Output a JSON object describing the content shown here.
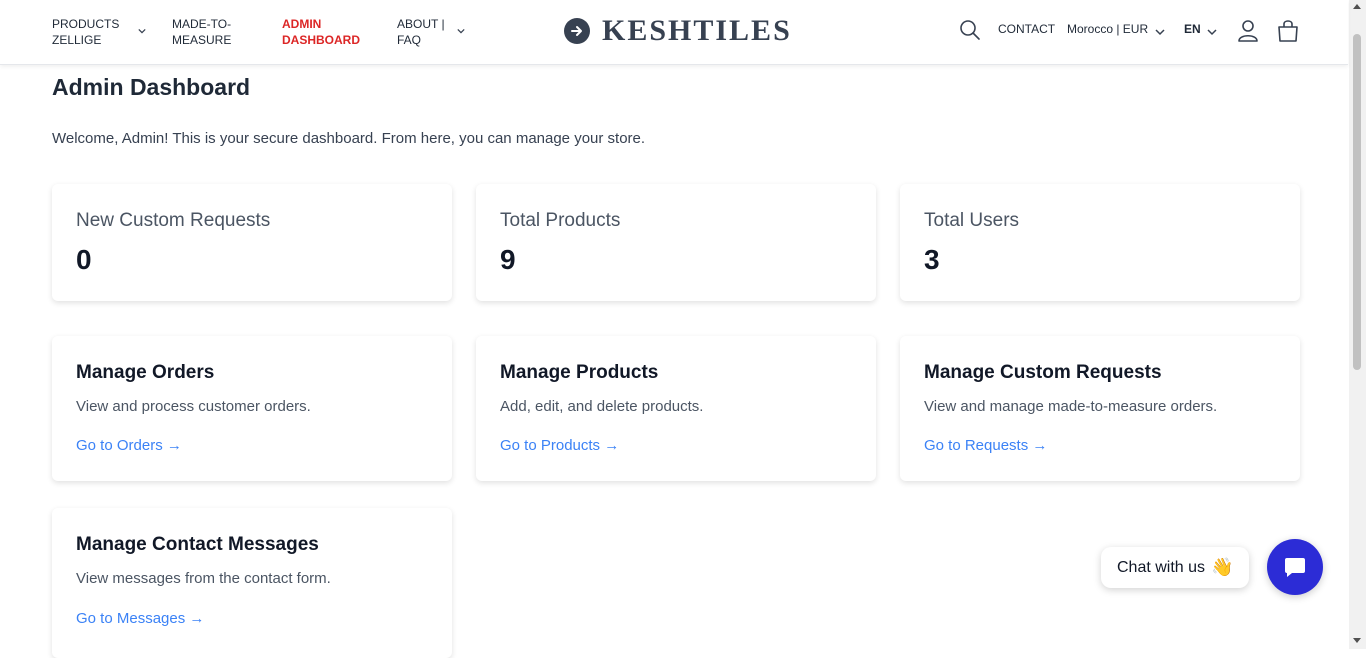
{
  "nav": {
    "items": [
      {
        "label": "PRODUCTS ZELLIGE"
      },
      {
        "label": "MADE-TO-MEASURE"
      },
      {
        "label": "ADMIN DASHBOARD"
      },
      {
        "label": "ABOUT | FAQ"
      }
    ],
    "logo_text": "KESHTILES",
    "contact": "CONTACT",
    "region": "Morocco | EUR",
    "language": "EN"
  },
  "main": {
    "title": "Admin Dashboard",
    "welcome": "Welcome, Admin! This is your secure dashboard. From here, you can manage your store.",
    "stats": [
      {
        "label": "New Custom Requests",
        "value": "0"
      },
      {
        "label": "Total Products",
        "value": "9"
      },
      {
        "label": "Total Users",
        "value": "3"
      }
    ],
    "manage": [
      {
        "title": "Manage Orders",
        "desc": "View and process customer orders.",
        "link": "Go to Orders →"
      },
      {
        "title": "Manage Products",
        "desc": "Add, edit, and delete products.",
        "link": "Go to Products →"
      },
      {
        "title": "Manage Custom Requests",
        "desc": "View and manage made-to-measure orders.",
        "link": "Go to Requests →"
      },
      {
        "title": "Manage Contact Messages",
        "desc": "View messages from the contact form.",
        "link": "Go to Messages →"
      }
    ]
  },
  "chat": {
    "label": "Chat with us",
    "emoji": "👋"
  },
  "colors": {
    "active_nav": "#dc2626",
    "link": "#3b82f6",
    "chat_button": "#2c2cd6"
  }
}
